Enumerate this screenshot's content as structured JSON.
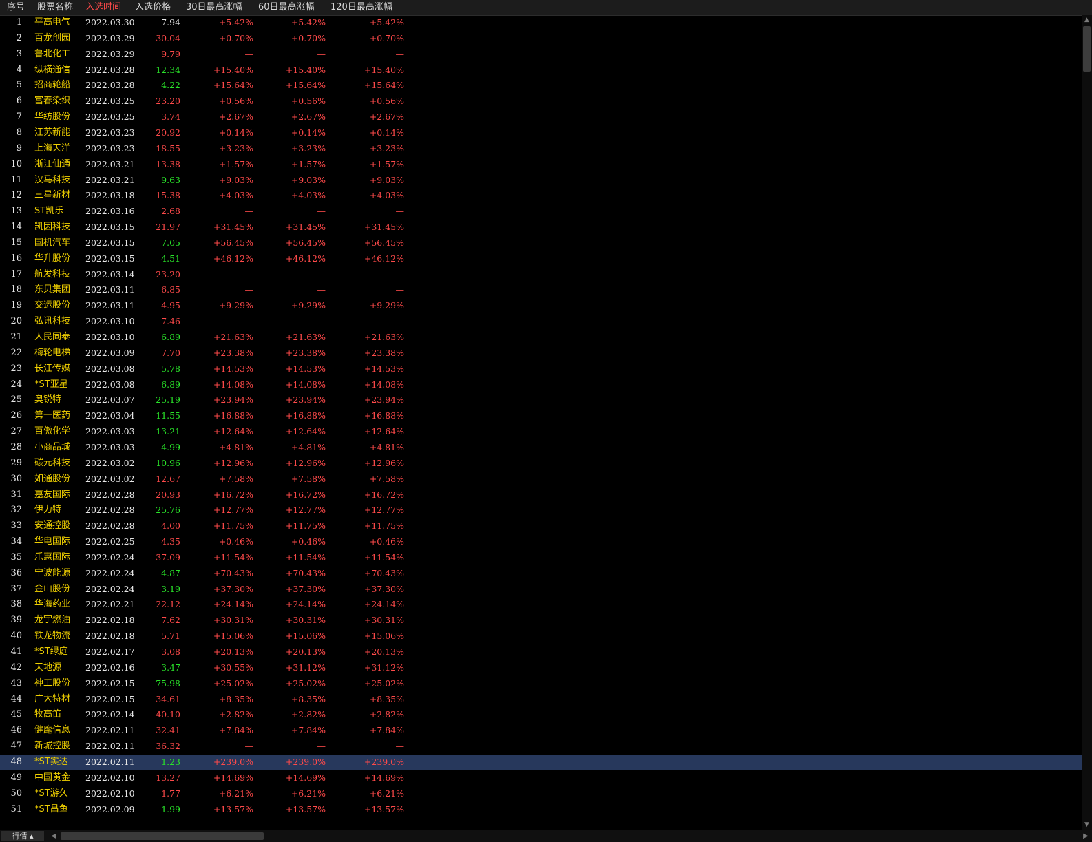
{
  "columns": [
    {
      "key": "no",
      "label": "序号"
    },
    {
      "key": "name",
      "label": "股票名称"
    },
    {
      "key": "date",
      "label": "入选时间"
    },
    {
      "key": "price",
      "label": "入选价格"
    },
    {
      "key": "g30",
      "label": "30日最高涨幅"
    },
    {
      "key": "g60",
      "label": "60日最高涨幅"
    },
    {
      "key": "g120",
      "label": "120日最高涨幅"
    }
  ],
  "active_column": "date",
  "selected_row": 48,
  "rows": [
    {
      "no": "1",
      "name": "平高电气",
      "date": "2022.03.30",
      "price": "7.94",
      "price_color": "white",
      "g30": "+5.42%",
      "g60": "+5.42%",
      "g120": "+5.42%"
    },
    {
      "no": "2",
      "name": "百龙创园",
      "date": "2022.03.29",
      "price": "30.04",
      "price_color": "red",
      "g30": "+0.70%",
      "g60": "+0.70%",
      "g120": "+0.70%"
    },
    {
      "no": "3",
      "name": "鲁北化工",
      "date": "2022.03.29",
      "price": "9.79",
      "price_color": "red",
      "g30": "—",
      "g60": "—",
      "g120": "—"
    },
    {
      "no": "4",
      "name": "纵横通信",
      "date": "2022.03.28",
      "price": "12.34",
      "price_color": "green",
      "g30": "+15.40%",
      "g60": "+15.40%",
      "g120": "+15.40%"
    },
    {
      "no": "5",
      "name": "招商轮船",
      "date": "2022.03.28",
      "price": "4.22",
      "price_color": "green",
      "g30": "+15.64%",
      "g60": "+15.64%",
      "g120": "+15.64%"
    },
    {
      "no": "6",
      "name": "富春染织",
      "date": "2022.03.25",
      "price": "23.20",
      "price_color": "red",
      "g30": "+0.56%",
      "g60": "+0.56%",
      "g120": "+0.56%"
    },
    {
      "no": "7",
      "name": "华纺股份",
      "date": "2022.03.25",
      "price": "3.74",
      "price_color": "red",
      "g30": "+2.67%",
      "g60": "+2.67%",
      "g120": "+2.67%"
    },
    {
      "no": "8",
      "name": "江苏新能",
      "date": "2022.03.23",
      "price": "20.92",
      "price_color": "red",
      "g30": "+0.14%",
      "g60": "+0.14%",
      "g120": "+0.14%"
    },
    {
      "no": "9",
      "name": "上海天洋",
      "date": "2022.03.23",
      "price": "18.55",
      "price_color": "red",
      "g30": "+3.23%",
      "g60": "+3.23%",
      "g120": "+3.23%"
    },
    {
      "no": "10",
      "name": "浙江仙通",
      "date": "2022.03.21",
      "price": "13.38",
      "price_color": "red",
      "g30": "+1.57%",
      "g60": "+1.57%",
      "g120": "+1.57%"
    },
    {
      "no": "11",
      "name": "汉马科技",
      "date": "2022.03.21",
      "price": "9.63",
      "price_color": "green",
      "g30": "+9.03%",
      "g60": "+9.03%",
      "g120": "+9.03%"
    },
    {
      "no": "12",
      "name": "三星新材",
      "date": "2022.03.18",
      "price": "15.38",
      "price_color": "red",
      "g30": "+4.03%",
      "g60": "+4.03%",
      "g120": "+4.03%"
    },
    {
      "no": "13",
      "name": "ST凯乐",
      "date": "2022.03.16",
      "price": "2.68",
      "price_color": "red",
      "g30": "—",
      "g60": "—",
      "g120": "—"
    },
    {
      "no": "14",
      "name": "凯因科技",
      "date": "2022.03.15",
      "price": "21.97",
      "price_color": "red",
      "g30": "+31.45%",
      "g60": "+31.45%",
      "g120": "+31.45%"
    },
    {
      "no": "15",
      "name": "国机汽车",
      "date": "2022.03.15",
      "price": "7.05",
      "price_color": "green",
      "g30": "+56.45%",
      "g60": "+56.45%",
      "g120": "+56.45%"
    },
    {
      "no": "16",
      "name": "华升股份",
      "date": "2022.03.15",
      "price": "4.51",
      "price_color": "green",
      "g30": "+46.12%",
      "g60": "+46.12%",
      "g120": "+46.12%"
    },
    {
      "no": "17",
      "name": "航发科技",
      "date": "2022.03.14",
      "price": "23.20",
      "price_color": "red",
      "g30": "—",
      "g60": "—",
      "g120": "—"
    },
    {
      "no": "18",
      "name": "东贝集团",
      "date": "2022.03.11",
      "price": "6.85",
      "price_color": "red",
      "g30": "—",
      "g60": "—",
      "g120": "—"
    },
    {
      "no": "19",
      "name": "交运股份",
      "date": "2022.03.11",
      "price": "4.95",
      "price_color": "red",
      "g30": "+9.29%",
      "g60": "+9.29%",
      "g120": "+9.29%"
    },
    {
      "no": "20",
      "name": "弘讯科技",
      "date": "2022.03.10",
      "price": "7.46",
      "price_color": "red",
      "g30": "—",
      "g60": "—",
      "g120": "—"
    },
    {
      "no": "21",
      "name": "人民同泰",
      "date": "2022.03.10",
      "price": "6.89",
      "price_color": "green",
      "g30": "+21.63%",
      "g60": "+21.63%",
      "g120": "+21.63%"
    },
    {
      "no": "22",
      "name": "梅轮电梯",
      "date": "2022.03.09",
      "price": "7.70",
      "price_color": "red",
      "g30": "+23.38%",
      "g60": "+23.38%",
      "g120": "+23.38%"
    },
    {
      "no": "23",
      "name": "长江传媒",
      "date": "2022.03.08",
      "price": "5.78",
      "price_color": "green",
      "g30": "+14.53%",
      "g60": "+14.53%",
      "g120": "+14.53%"
    },
    {
      "no": "24",
      "name": "*ST亚星",
      "date": "2022.03.08",
      "price": "6.89",
      "price_color": "green",
      "g30": "+14.08%",
      "g60": "+14.08%",
      "g120": "+14.08%"
    },
    {
      "no": "25",
      "name": "奥锐特",
      "date": "2022.03.07",
      "price": "25.19",
      "price_color": "green",
      "g30": "+23.94%",
      "g60": "+23.94%",
      "g120": "+23.94%"
    },
    {
      "no": "26",
      "name": "第一医药",
      "date": "2022.03.04",
      "price": "11.55",
      "price_color": "green",
      "g30": "+16.88%",
      "g60": "+16.88%",
      "g120": "+16.88%"
    },
    {
      "no": "27",
      "name": "百傲化学",
      "date": "2022.03.03",
      "price": "13.21",
      "price_color": "green",
      "g30": "+12.64%",
      "g60": "+12.64%",
      "g120": "+12.64%"
    },
    {
      "no": "28",
      "name": "小商品城",
      "date": "2022.03.03",
      "price": "4.99",
      "price_color": "green",
      "g30": "+4.81%",
      "g60": "+4.81%",
      "g120": "+4.81%"
    },
    {
      "no": "29",
      "name": "碳元科技",
      "date": "2022.03.02",
      "price": "10.96",
      "price_color": "green",
      "g30": "+12.96%",
      "g60": "+12.96%",
      "g120": "+12.96%"
    },
    {
      "no": "30",
      "name": "如通股份",
      "date": "2022.03.02",
      "price": "12.67",
      "price_color": "red",
      "g30": "+7.58%",
      "g60": "+7.58%",
      "g120": "+7.58%"
    },
    {
      "no": "31",
      "name": "嘉友国际",
      "date": "2022.02.28",
      "price": "20.93",
      "price_color": "red",
      "g30": "+16.72%",
      "g60": "+16.72%",
      "g120": "+16.72%"
    },
    {
      "no": "32",
      "name": "伊力特",
      "date": "2022.02.28",
      "price": "25.76",
      "price_color": "green",
      "g30": "+12.77%",
      "g60": "+12.77%",
      "g120": "+12.77%"
    },
    {
      "no": "33",
      "name": "安通控股",
      "date": "2022.02.28",
      "price": "4.00",
      "price_color": "red",
      "g30": "+11.75%",
      "g60": "+11.75%",
      "g120": "+11.75%"
    },
    {
      "no": "34",
      "name": "华电国际",
      "date": "2022.02.25",
      "price": "4.35",
      "price_color": "red",
      "g30": "+0.46%",
      "g60": "+0.46%",
      "g120": "+0.46%"
    },
    {
      "no": "35",
      "name": "乐惠国际",
      "date": "2022.02.24",
      "price": "37.09",
      "price_color": "red",
      "g30": "+11.54%",
      "g60": "+11.54%",
      "g120": "+11.54%"
    },
    {
      "no": "36",
      "name": "宁波能源",
      "date": "2022.02.24",
      "price": "4.87",
      "price_color": "green",
      "g30": "+70.43%",
      "g60": "+70.43%",
      "g120": "+70.43%"
    },
    {
      "no": "37",
      "name": "金山股份",
      "date": "2022.02.24",
      "price": "3.19",
      "price_color": "green",
      "g30": "+37.30%",
      "g60": "+37.30%",
      "g120": "+37.30%"
    },
    {
      "no": "38",
      "name": "华海药业",
      "date": "2022.02.21",
      "price": "22.12",
      "price_color": "red",
      "g30": "+24.14%",
      "g60": "+24.14%",
      "g120": "+24.14%"
    },
    {
      "no": "39",
      "name": "龙宇燃油",
      "date": "2022.02.18",
      "price": "7.62",
      "price_color": "red",
      "g30": "+30.31%",
      "g60": "+30.31%",
      "g120": "+30.31%"
    },
    {
      "no": "40",
      "name": "铁龙物流",
      "date": "2022.02.18",
      "price": "5.71",
      "price_color": "red",
      "g30": "+15.06%",
      "g60": "+15.06%",
      "g120": "+15.06%"
    },
    {
      "no": "41",
      "name": "*ST绿庭",
      "date": "2022.02.17",
      "price": "3.08",
      "price_color": "red",
      "g30": "+20.13%",
      "g60": "+20.13%",
      "g120": "+20.13%"
    },
    {
      "no": "42",
      "name": "天地源",
      "date": "2022.02.16",
      "price": "3.47",
      "price_color": "green",
      "g30": "+30.55%",
      "g60": "+31.12%",
      "g120": "+31.12%"
    },
    {
      "no": "43",
      "name": "神工股份",
      "date": "2022.02.15",
      "price": "75.98",
      "price_color": "green",
      "g30": "+25.02%",
      "g60": "+25.02%",
      "g120": "+25.02%"
    },
    {
      "no": "44",
      "name": "广大特材",
      "date": "2022.02.15",
      "price": "34.61",
      "price_color": "red",
      "g30": "+8.35%",
      "g60": "+8.35%",
      "g120": "+8.35%"
    },
    {
      "no": "45",
      "name": "牧高笛",
      "date": "2022.02.14",
      "price": "40.10",
      "price_color": "red",
      "g30": "+2.82%",
      "g60": "+2.82%",
      "g120": "+2.82%"
    },
    {
      "no": "46",
      "name": "健麾信息",
      "date": "2022.02.11",
      "price": "32.41",
      "price_color": "red",
      "g30": "+7.84%",
      "g60": "+7.84%",
      "g120": "+7.84%"
    },
    {
      "no": "47",
      "name": "新城控股",
      "date": "2022.02.11",
      "price": "36.32",
      "price_color": "red",
      "g30": "—",
      "g60": "—",
      "g120": "—"
    },
    {
      "no": "48",
      "name": "*ST实达",
      "date": "2022.02.11",
      "price": "1.23",
      "price_color": "green",
      "g30": "+239.0%",
      "g60": "+239.0%",
      "g120": "+239.0%"
    },
    {
      "no": "49",
      "name": "中国黄金",
      "date": "2022.02.10",
      "price": "13.27",
      "price_color": "red",
      "g30": "+14.69%",
      "g60": "+14.69%",
      "g120": "+14.69%"
    },
    {
      "no": "50",
      "name": "*ST游久",
      "date": "2022.02.10",
      "price": "1.77",
      "price_color": "red",
      "g30": "+6.21%",
      "g60": "+6.21%",
      "g120": "+6.21%"
    },
    {
      "no": "51",
      "name": "*ST昌鱼",
      "date": "2022.02.09",
      "price": "1.99",
      "price_color": "green",
      "g30": "+13.57%",
      "g60": "+13.57%",
      "g120": "+13.57%"
    }
  ],
  "bottom_tab": {
    "label": "行情 ▴"
  },
  "colors": {
    "up": "#ff4a4a",
    "down": "#29e329",
    "name": "#f0d000",
    "selected_row_bg": "#27385c",
    "background": "#000000"
  },
  "icons": {
    "scroll_up": "chevron-up-icon",
    "scroll_down": "chevron-down-icon",
    "scroll_left": "chevron-left-icon",
    "scroll_right": "chevron-right-icon"
  }
}
